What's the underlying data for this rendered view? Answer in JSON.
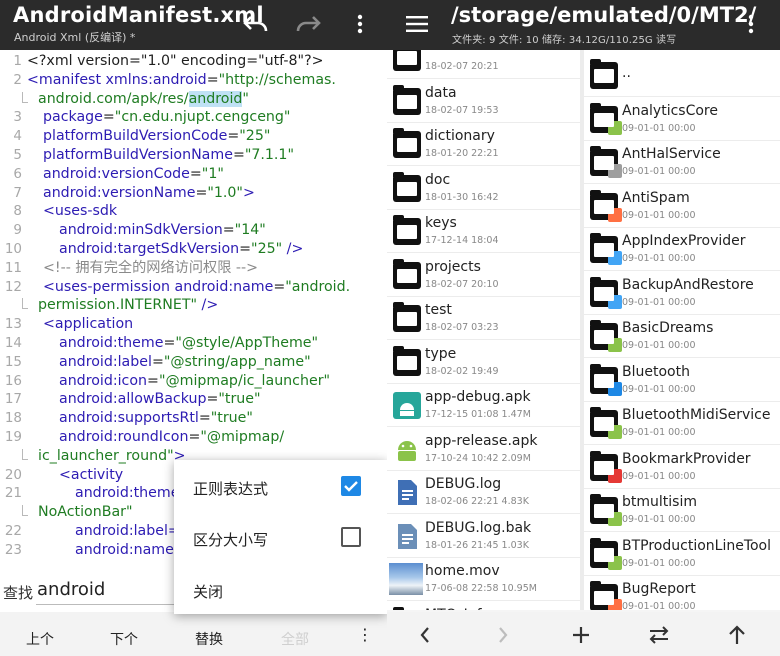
{
  "editor": {
    "title": "AndroidManifest.xml",
    "subtitle": "Android Xml (反编译) *",
    "icons": [
      "undo-icon",
      "redo-icon",
      "more-vert-icon"
    ],
    "code_lines": [
      {
        "n": "1",
        "segs": [
          [
            "pun",
            "<?xml version=\"1.0\" encoding=\"utf-8\"?>"
          ]
        ]
      },
      {
        "n": "2",
        "segs": [
          [
            "tag",
            "<manifest "
          ],
          [
            "attr",
            "xmlns:android"
          ],
          [
            "pun",
            "="
          ],
          [
            "str",
            "\"http://schemas."
          ]
        ]
      },
      {
        "n": "",
        "wrap": true,
        "segs": [
          [
            "str",
            "android.com/apk/res/"
          ],
          [
            "hl",
            "android"
          ],
          [
            "str",
            "\""
          ]
        ]
      },
      {
        "n": "3",
        "ind": 16,
        "segs": [
          [
            "attr",
            "package"
          ],
          [
            "pun",
            "="
          ],
          [
            "str",
            "\"cn.edu.njupt.cengceng\""
          ]
        ]
      },
      {
        "n": "4",
        "ind": 16,
        "segs": [
          [
            "attr",
            "platformBuildVersionCode"
          ],
          [
            "pun",
            "="
          ],
          [
            "str",
            "\"25\""
          ]
        ]
      },
      {
        "n": "5",
        "ind": 16,
        "segs": [
          [
            "attr",
            "platformBuildVersionName"
          ],
          [
            "pun",
            "="
          ],
          [
            "str",
            "\"7.1.1\""
          ]
        ]
      },
      {
        "n": "6",
        "ind": 16,
        "segs": [
          [
            "attr",
            "android:versionCode"
          ],
          [
            "pun",
            "="
          ],
          [
            "str",
            "\"1\""
          ]
        ]
      },
      {
        "n": "7",
        "ind": 16,
        "segs": [
          [
            "attr",
            "android:versionName"
          ],
          [
            "pun",
            "="
          ],
          [
            "str",
            "\"1.0\""
          ],
          [
            "tag",
            ">"
          ]
        ]
      },
      {
        "n": "8",
        "ind": 16,
        "segs": [
          [
            "tag",
            "<uses-sdk"
          ]
        ]
      },
      {
        "n": "9",
        "ind": 32,
        "segs": [
          [
            "attr",
            "android:minSdkVersion"
          ],
          [
            "pun",
            "="
          ],
          [
            "str",
            "\"14\""
          ]
        ]
      },
      {
        "n": "10",
        "ind": 32,
        "segs": [
          [
            "attr",
            "android:targetSdkVersion"
          ],
          [
            "pun",
            "="
          ],
          [
            "str",
            "\"25\""
          ],
          [
            "tag",
            " />"
          ]
        ]
      },
      {
        "n": "11",
        "ind": 16,
        "segs": [
          [
            "cmt",
            "<!-- 拥有完全的网络访问权限 -->"
          ]
        ]
      },
      {
        "n": "12",
        "ind": 16,
        "segs": [
          [
            "tag",
            "<uses-permission "
          ],
          [
            "attr",
            "android:name"
          ],
          [
            "pun",
            "="
          ],
          [
            "str",
            "\"android."
          ]
        ]
      },
      {
        "n": "",
        "wrap": true,
        "segs": [
          [
            "str",
            "permission.INTERNET\""
          ],
          [
            "tag",
            " />"
          ]
        ]
      },
      {
        "n": "13",
        "ind": 16,
        "segs": [
          [
            "tag",
            "<application"
          ]
        ]
      },
      {
        "n": "14",
        "ind": 32,
        "segs": [
          [
            "attr",
            "android:theme"
          ],
          [
            "pun",
            "="
          ],
          [
            "str",
            "\"@style/AppTheme\""
          ]
        ]
      },
      {
        "n": "15",
        "ind": 32,
        "segs": [
          [
            "attr",
            "android:label"
          ],
          [
            "pun",
            "="
          ],
          [
            "str",
            "\"@string/app_name\""
          ]
        ]
      },
      {
        "n": "16",
        "ind": 32,
        "segs": [
          [
            "attr",
            "android:icon"
          ],
          [
            "pun",
            "="
          ],
          [
            "str",
            "\"@mipmap/ic_launcher\""
          ]
        ]
      },
      {
        "n": "17",
        "ind": 32,
        "segs": [
          [
            "attr",
            "android:allowBackup"
          ],
          [
            "pun",
            "="
          ],
          [
            "str",
            "\"true\""
          ]
        ]
      },
      {
        "n": "18",
        "ind": 32,
        "segs": [
          [
            "attr",
            "android:supportsRtl"
          ],
          [
            "pun",
            "="
          ],
          [
            "str",
            "\"true\""
          ]
        ]
      },
      {
        "n": "19",
        "ind": 32,
        "segs": [
          [
            "attr",
            "android:roundIcon"
          ],
          [
            "pun",
            "="
          ],
          [
            "str",
            "\"@mipmap/"
          ]
        ]
      },
      {
        "n": "",
        "wrap": true,
        "segs": [
          [
            "str",
            "ic_launcher_round\""
          ],
          [
            "tag",
            ">"
          ]
        ]
      },
      {
        "n": "20",
        "ind": 32,
        "segs": [
          [
            "tag",
            "<activity"
          ]
        ]
      },
      {
        "n": "21",
        "ind": 48,
        "segs": [
          [
            "attr",
            "android:theme"
          ]
        ]
      },
      {
        "n": "",
        "wrap": true,
        "segs": [
          [
            "str",
            "NoActionBar\""
          ]
        ]
      },
      {
        "n": "22",
        "ind": 48,
        "segs": [
          [
            "attr",
            "android:label="
          ]
        ]
      },
      {
        "n": "23",
        "ind": 48,
        "segs": [
          [
            "attr",
            "android:name"
          ]
        ]
      }
    ]
  },
  "find": {
    "label": "查找",
    "value": "android"
  },
  "popup": {
    "regex_label": "正则表达式",
    "case_label": "区分大小写",
    "close_label": "关闭",
    "regex_checked": true,
    "case_checked": false,
    "accent": "#1e88e5"
  },
  "bottom_left": {
    "prev": "上个",
    "next": "下个",
    "replace": "替换",
    "all": "全部"
  },
  "files": {
    "path": "/storage/emulated/0/MT2/",
    "info": "文件夹: 9  文件: 10  储存: 34.12G/110.25G  读写",
    "left_list": [
      {
        "name": "",
        "meta": "18-02-07 20:21",
        "type": "folder"
      },
      {
        "name": "data",
        "meta": "18-02-07 19:53",
        "type": "folder"
      },
      {
        "name": "dictionary",
        "meta": "18-01-20 22:21",
        "type": "folder"
      },
      {
        "name": "doc",
        "meta": "18-01-30 16:42",
        "type": "folder"
      },
      {
        "name": "keys",
        "meta": "17-12-14 18:04",
        "type": "folder"
      },
      {
        "name": "projects",
        "meta": "18-02-07 20:10",
        "type": "folder"
      },
      {
        "name": "test",
        "meta": "18-02-07 03:23",
        "type": "folder"
      },
      {
        "name": "type",
        "meta": "18-02-02 19:49",
        "type": "folder"
      },
      {
        "name": "app-debug.apk",
        "meta": "17-12-15 01:08  1.47M",
        "type": "apk-debug"
      },
      {
        "name": "app-release.apk",
        "meta": "17-10-24 10:42  2.09M",
        "type": "apk"
      },
      {
        "name": "DEBUG.log",
        "meta": "18-02-06 22:21  4.83K",
        "type": "doc"
      },
      {
        "name": "DEBUG.log.bak",
        "meta": "18-01-26 21:45  1.03K",
        "type": "doc-bak"
      },
      {
        "name": "home.mov",
        "meta": "17-06-08 22:58  10.95M",
        "type": "video"
      },
      {
        "name": "MTO_Info...",
        "meta": "",
        "type": "folder"
      }
    ],
    "right_list": [
      {
        "name": "..",
        "meta": "",
        "badge": "",
        "badge_color": ""
      },
      {
        "name": "AnalyticsCore",
        "meta": "09-01-01 00:00",
        "badge": "android-icon",
        "badge_color": "#8bc34a"
      },
      {
        "name": "AntHalService",
        "meta": "09-01-01 00:00",
        "badge": "gear-icon",
        "badge_color": "#9e9e9e"
      },
      {
        "name": "AntiSpam",
        "meta": "09-01-01 00:00",
        "badge": "shield-icon",
        "badge_color": "#ff7043"
      },
      {
        "name": "AppIndexProvider",
        "meta": "09-01-01 00:00",
        "badge": "gear-icon",
        "badge_color": "#42a5f5"
      },
      {
        "name": "BackupAndRestore",
        "meta": "09-01-01 00:00",
        "badge": "backup-icon",
        "badge_color": "#42a5f5"
      },
      {
        "name": "BasicDreams",
        "meta": "09-01-01 00:00",
        "badge": "android-icon",
        "badge_color": "#8bc34a"
      },
      {
        "name": "Bluetooth",
        "meta": "09-01-01 00:00",
        "badge": "bluetooth-icon",
        "badge_color": "#1e88e5"
      },
      {
        "name": "BluetoothMidiService",
        "meta": "09-01-01 00:00",
        "badge": "android-icon",
        "badge_color": "#8bc34a"
      },
      {
        "name": "BookmarkProvider",
        "meta": "09-01-01 00:00",
        "badge": "bookmark-icon",
        "badge_color": "#e53935"
      },
      {
        "name": "btmultisim",
        "meta": "09-01-01 00:00",
        "badge": "android-icon",
        "badge_color": "#8bc34a"
      },
      {
        "name": "BTProductionLineTool",
        "meta": "09-01-01 00:00",
        "badge": "android-icon",
        "badge_color": "#8bc34a"
      },
      {
        "name": "BugReport",
        "meta": "09-01-01 00:00",
        "badge": "bug-icon",
        "badge_color": "#ff7043"
      }
    ],
    "bottom_icons": [
      "chevron-left-icon",
      "chevron-right-icon",
      "add-icon",
      "swap-icon",
      "arrow-up-icon"
    ]
  }
}
